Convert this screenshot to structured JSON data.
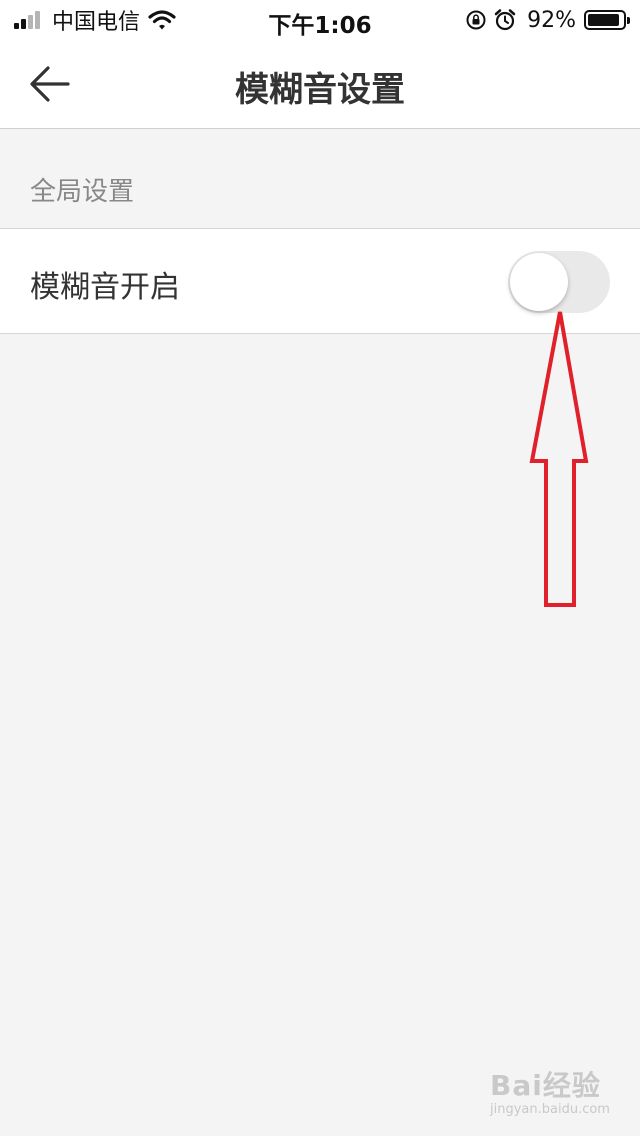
{
  "status_bar": {
    "carrier": "中国电信",
    "time": "下午1:06",
    "battery_percent": "92%",
    "battery_level": 0.92,
    "signal_bars_filled": 2,
    "icons": [
      "signal-icon",
      "wifi-icon",
      "orientation-lock-icon",
      "alarm-icon",
      "battery-icon"
    ]
  },
  "nav": {
    "title": "模糊音设置",
    "back_icon": "arrow-left-icon"
  },
  "sections": [
    {
      "header": "全局设置",
      "rows": [
        {
          "label": "模糊音开启",
          "toggle_on": false
        }
      ]
    }
  ],
  "colors": {
    "annotation_arrow": "#e0202a",
    "toggle_off_track": "#e9e9ea",
    "page_background": "#f4f4f4"
  },
  "watermark": {
    "main": "Bai经验",
    "sub": "jingyan.baidu.com"
  }
}
